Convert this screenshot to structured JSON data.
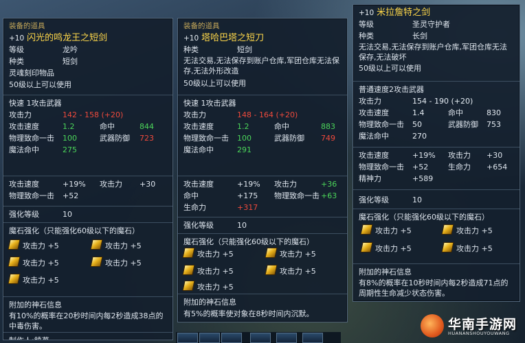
{
  "panel1": {
    "header": "装备的道具",
    "title_level": "+10",
    "title_name": "闪光的鸣龙王之短剑",
    "grade_label": "等级",
    "grade_value": "龙吟",
    "type_label": "种类",
    "type_value": "短剑",
    "soul_note": "灵魂刻印物品",
    "req_level": "50级以上可以使用",
    "speed_line": "快速 1攻击武器",
    "attack_label": "攻击力",
    "attack_value": "142 - 158 (+20)",
    "aspd_label": "攻击速度",
    "aspd_value": "1.2",
    "hit_label": "命中",
    "hit_value": "844",
    "crit_label": "物理致命一击",
    "crit_value": "100",
    "block_label": "武器防御",
    "block_value": "723",
    "mhit_label": "魔法命中",
    "mhit_value": "275",
    "bonus": [
      {
        "l1": "攻击速度",
        "v1": "+19%",
        "l2": "攻击力",
        "v2": "+30"
      },
      {
        "l1": "物理致命一击",
        "v1": "+52",
        "l2": "",
        "v2": ""
      }
    ],
    "enchant_label": "强化等级",
    "enchant_value": "10",
    "manastone_title": "魔石强化（只能强化60级以下的魔石）",
    "manastones": [
      "攻击力 +5",
      "攻击力 +5",
      "攻击力 +5",
      "攻击力 +5",
      "攻击力 +5"
    ],
    "godstone_title": "附加的神石信息",
    "godstone_desc": "有10%的概率在20秒时间内每2秒造成38点的中毒伤害。",
    "maker": "制作人:饒苺"
  },
  "panel2": {
    "header": "装备的道具",
    "title_level": "+10",
    "title_name": "塔哈巴塔之短刀",
    "type_label": "种类",
    "type_value": "短剑",
    "restrict": "无法交易,无法保存到账户仓库,军团仓库无法保存,无法外形改造",
    "req_level": "50级以上可以使用",
    "speed_line": "快速 1攻击武器",
    "attack_label": "攻击力",
    "attack_value": "148 - 164 (+20)",
    "aspd_label": "攻击速度",
    "aspd_value": "1.2",
    "hit_label": "命中",
    "hit_value": "883",
    "crit_label": "物理致命一击",
    "crit_value": "100",
    "block_label": "武器防御",
    "block_value": "749",
    "mhit_label": "魔法命中",
    "mhit_value": "291",
    "bonus": [
      {
        "l1": "攻击速度",
        "v1": "+19%",
        "l2": "攻击力",
        "v2": "+36"
      },
      {
        "l1": "命中",
        "v1": "+175",
        "l2": "物理致命一击",
        "v2": "+63"
      },
      {
        "l1": "生命力",
        "v1": "+317",
        "l2": "",
        "v2": ""
      }
    ],
    "enchant_label": "强化等级",
    "enchant_value": "10",
    "manastone_title": "魔石强化（只能强化60级以下的魔石）",
    "manastones": [
      "攻击力 +5",
      "攻击力 +5",
      "攻击力 +5",
      "攻击力 +5",
      "攻击力 +5"
    ],
    "godstone_title": "附加的神石信息",
    "godstone_desc": "有5%的概率使对象在8秒时间内沉默。"
  },
  "panel3": {
    "title_level": "+10",
    "title_name": "米拉詹特之剑",
    "grade_label": "等级",
    "grade_value": "圣灵守护者",
    "type_label": "种类",
    "type_value": "长剑",
    "restrict": "无法交易,无法保存到账户仓库,军团仓库无法保存,无法破坏",
    "req_level": "50级以上可以使用",
    "speed_line": "普通速度2攻击武器",
    "attack_label": "攻击力",
    "attack_value": "154 - 190 (+20)",
    "aspd_label": "攻击速度",
    "aspd_value": "1.4",
    "hit_label": "命中",
    "hit_value": "830",
    "crit_label": "物理致命一击",
    "crit_value": "50",
    "block_label": "武器防御",
    "block_value": "753",
    "mhit_label": "魔法命中",
    "mhit_value": "270",
    "bonus": [
      {
        "l1": "攻击速度",
        "v1": "+19%",
        "l2": "攻击力",
        "v2": "+30"
      },
      {
        "l1": "物理致命一击",
        "v1": "+52",
        "l2": "生命力",
        "v2": "+654"
      },
      {
        "l1": "精神力",
        "v1": "+589",
        "l2": "",
        "v2": ""
      }
    ],
    "enchant_label": "强化等级",
    "enchant_value": "10",
    "manastone_title": "魔石强化（只能强化60级以下的魔石）",
    "manastones": [
      "攻击力 +5",
      "攻击力 +5",
      "攻击力 +5",
      "攻击力 +5"
    ],
    "godstone_title": "附加的神石信息",
    "godstone_desc": "有8%的概率在10秒时间内每2秒造成71点的周期性生命减少状态伤害。"
  },
  "watermark": {
    "name": "华南手游网",
    "sub": "HUANANSHOUYOUWANG"
  },
  "colors": {
    "title": "#ffd84a",
    "green_stat": "#4cd65a",
    "red_stat": "#f04a3c",
    "header": "#c5a85a"
  }
}
